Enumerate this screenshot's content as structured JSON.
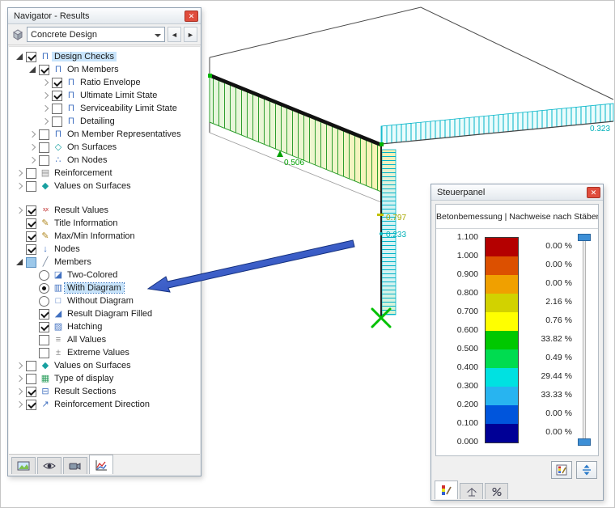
{
  "navigator": {
    "title": "Navigator - Results",
    "dropdown_value": "Concrete Design",
    "tree": [
      {
        "label": "Design Checks",
        "icon": "Π",
        "icon_color": "#4070c0"
      },
      {
        "label": "On Members",
        "icon": "Π",
        "icon_color": "#4070c0"
      },
      {
        "label": "Ratio Envelope",
        "icon": "Π",
        "icon_color": "#4070c0"
      },
      {
        "label": "Ultimate Limit State",
        "icon": "Π",
        "icon_color": "#4070c0"
      },
      {
        "label": "Serviceability Limit State",
        "icon": "Π",
        "icon_color": "#4070c0"
      },
      {
        "label": "Detailing",
        "icon": "Π",
        "icon_color": "#4070c0"
      },
      {
        "label": "On Member Representatives",
        "icon": "Π",
        "icon_color": "#4070c0"
      },
      {
        "label": "On Surfaces",
        "icon": "◇",
        "icon_color": "#18a0a0"
      },
      {
        "label": "On Nodes",
        "icon": "∴",
        "icon_color": "#4070c0"
      },
      {
        "label": "Reinforcement",
        "icon": "▤",
        "icon_color": "#888888"
      },
      {
        "label": "Values on Surfaces",
        "icon": "◆",
        "icon_color": "#18a0a0"
      },
      {
        "label": "Result Values",
        "icon": "x,x",
        "icon_color": "#c03030"
      },
      {
        "label": "Title Information",
        "icon": "✎",
        "icon_color": "#b08820"
      },
      {
        "label": "Max/Min Information",
        "icon": "✎",
        "icon_color": "#b08820"
      },
      {
        "label": "Nodes",
        "icon": "↓",
        "icon_color": "#4070c0"
      },
      {
        "label": "Members",
        "icon": "╱",
        "icon_color": "#7a8aa0"
      },
      {
        "label": "Two-Colored",
        "icon": "◪",
        "icon_color": "#4070c0"
      },
      {
        "label": "With Diagram",
        "icon": "▥",
        "icon_color": "#4070c0"
      },
      {
        "label": "Without Diagram",
        "icon": "□",
        "icon_color": "#4070c0"
      },
      {
        "label": "Result Diagram Filled",
        "icon": "◢",
        "icon_color": "#4070c0"
      },
      {
        "label": "Hatching",
        "icon": "▨",
        "icon_color": "#4070c0"
      },
      {
        "label": "All Values",
        "icon": "≡",
        "icon_color": "#888888"
      },
      {
        "label": "Extreme Values",
        "icon": "±",
        "icon_color": "#888888"
      },
      {
        "label": "Values on Surfaces",
        "icon": "◆",
        "icon_color": "#18a0a0"
      },
      {
        "label": "Type of display",
        "icon": "▦",
        "icon_color": "#30a060"
      },
      {
        "label": "Result Sections",
        "icon": "⊟",
        "icon_color": "#4070c0"
      },
      {
        "label": "Reinforcement Direction",
        "icon": "↗",
        "icon_color": "#4070c0"
      }
    ]
  },
  "scene": {
    "labels": [
      {
        "text": "0.506",
        "color": "#00a000"
      },
      {
        "text": "0.797",
        "color": "#a8a800"
      },
      {
        "text": "0.233",
        "color": "#00b0b8"
      },
      {
        "text": "0.323",
        "color": "#00b0b8"
      }
    ]
  },
  "panel": {
    "title": "Steuerpanel",
    "header": "Betonbemessung | Nachweise nach Stäben",
    "scale": {
      "values": [
        "1.100",
        "1.000",
        "0.900",
        "0.800",
        "0.700",
        "0.600",
        "0.500",
        "0.400",
        "0.300",
        "0.200",
        "0.100",
        "0.000"
      ],
      "rows": [
        {
          "color": "#b40000",
          "percent": "0.00 %"
        },
        {
          "color": "#dc5000",
          "percent": "0.00 %"
        },
        {
          "color": "#f0a000",
          "percent": "0.00 %"
        },
        {
          "color": "#d2d200",
          "percent": "2.16 %"
        },
        {
          "color": "#ffff00",
          "percent": "0.76 %"
        },
        {
          "color": "#00c800",
          "percent": "33.82 %"
        },
        {
          "color": "#00dc50",
          "percent": "0.49 %"
        },
        {
          "color": "#00e1e1",
          "percent": "29.44 %"
        },
        {
          "color": "#28b4f0",
          "percent": "33.33 %"
        },
        {
          "color": "#0055dc",
          "percent": "0.00 %"
        },
        {
          "color": "#000096",
          "percent": "0.00 %"
        }
      ]
    }
  }
}
